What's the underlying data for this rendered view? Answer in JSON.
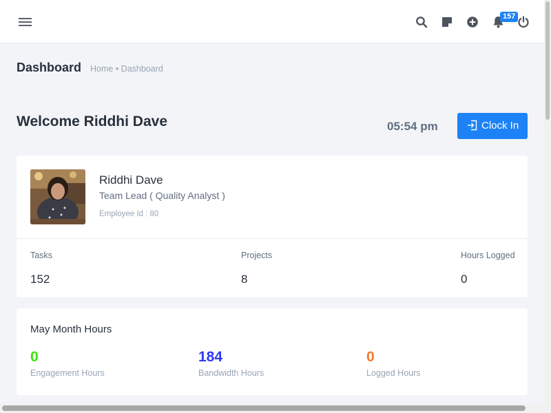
{
  "topbar": {
    "menu_icon": "hamburger-menu-icon",
    "icons": [
      "search-icon",
      "sticky-note-icon",
      "plus-circle-icon",
      "bell-icon",
      "power-icon"
    ],
    "notification_count": "157"
  },
  "page": {
    "title": "Dashboard",
    "breadcrumb": "Home • Dashboard"
  },
  "welcome": {
    "text": "Welcome Riddhi Dave",
    "time": "05:54 pm",
    "clock_in_label": "Clock In"
  },
  "profile": {
    "name": "Riddhi Dave",
    "role": "Team Lead ( Quality Analyst )",
    "employee_id": "Employee Id : 80",
    "stats": [
      {
        "label": "Tasks",
        "value": "152"
      },
      {
        "label": "Projects",
        "value": "8"
      },
      {
        "label": "Hours Logged",
        "value": "0"
      }
    ]
  },
  "month_hours": {
    "title": "May Month Hours",
    "items": [
      {
        "value": "0",
        "label": "Engagement Hours",
        "color": "#39e500"
      },
      {
        "value": "184",
        "label": "Bandwidth Hours",
        "color": "#2d38f5"
      },
      {
        "value": "0",
        "label": "Logged Hours",
        "color": "#f5792d"
      }
    ]
  },
  "colors": {
    "accent": "#1d82f5",
    "background": "#f2f4f7"
  }
}
